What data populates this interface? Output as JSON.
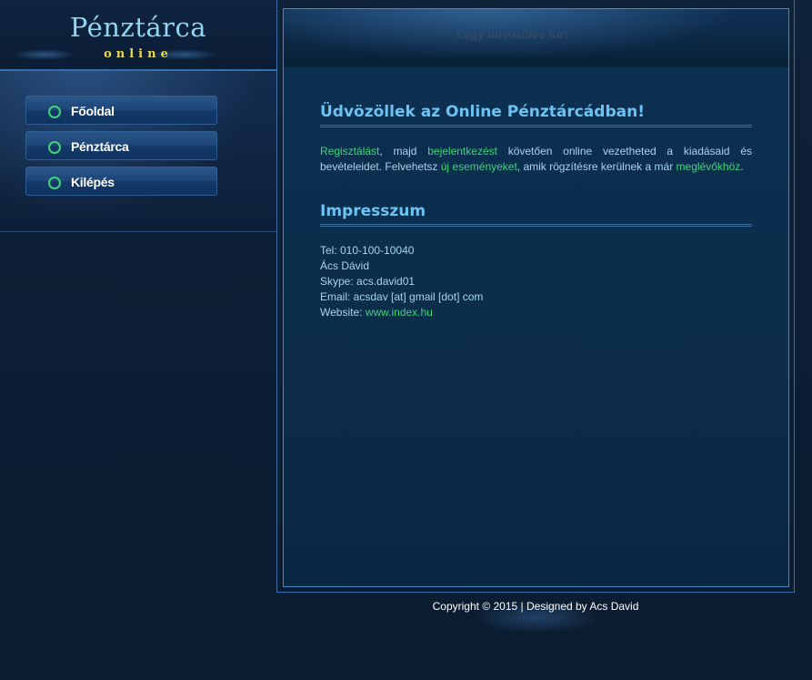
{
  "brand": {
    "title": "Pénztárca",
    "subtitle": "online"
  },
  "nav": {
    "items": [
      {
        "label": "Főoldal"
      },
      {
        "label": "Pénztárca"
      },
      {
        "label": "Kilépés"
      }
    ]
  },
  "header": {
    "welcome": "Légy üdvözölve tur!"
  },
  "intro": {
    "title": "Üdvözöllek az Online Pénztárcádban!",
    "link_register": "Regisztálást",
    "text_1": ", majd ",
    "link_login": "bejelentkezést",
    "text_2": " követően online vezetheted a kiadásaid és bevételeidet. Felvehetsz ",
    "link_events": "új eseményeket",
    "text_3": ", amik rögzítésre kerülnek a már ",
    "link_history": "meglévőkhöz",
    "text_4": "."
  },
  "impressum": {
    "title": "Impresszum",
    "tel": "Tel: 010-100-10040",
    "name": "Ács Dávid",
    "skype": "Skype: acs.david01",
    "email": "Email: acsdav [at] gmail [dot] com",
    "website_label": "Website: ",
    "website_link": "www.index.hu"
  },
  "footer": {
    "text": "Copyright © 2015 | Designed by Acs David"
  },
  "colors": {
    "accent_green": "#3fd37a",
    "heading_blue": "#6cc2f2",
    "logo_yellow": "#e8d84a"
  },
  "icons": {
    "nav_bullet": "ring-icon"
  }
}
